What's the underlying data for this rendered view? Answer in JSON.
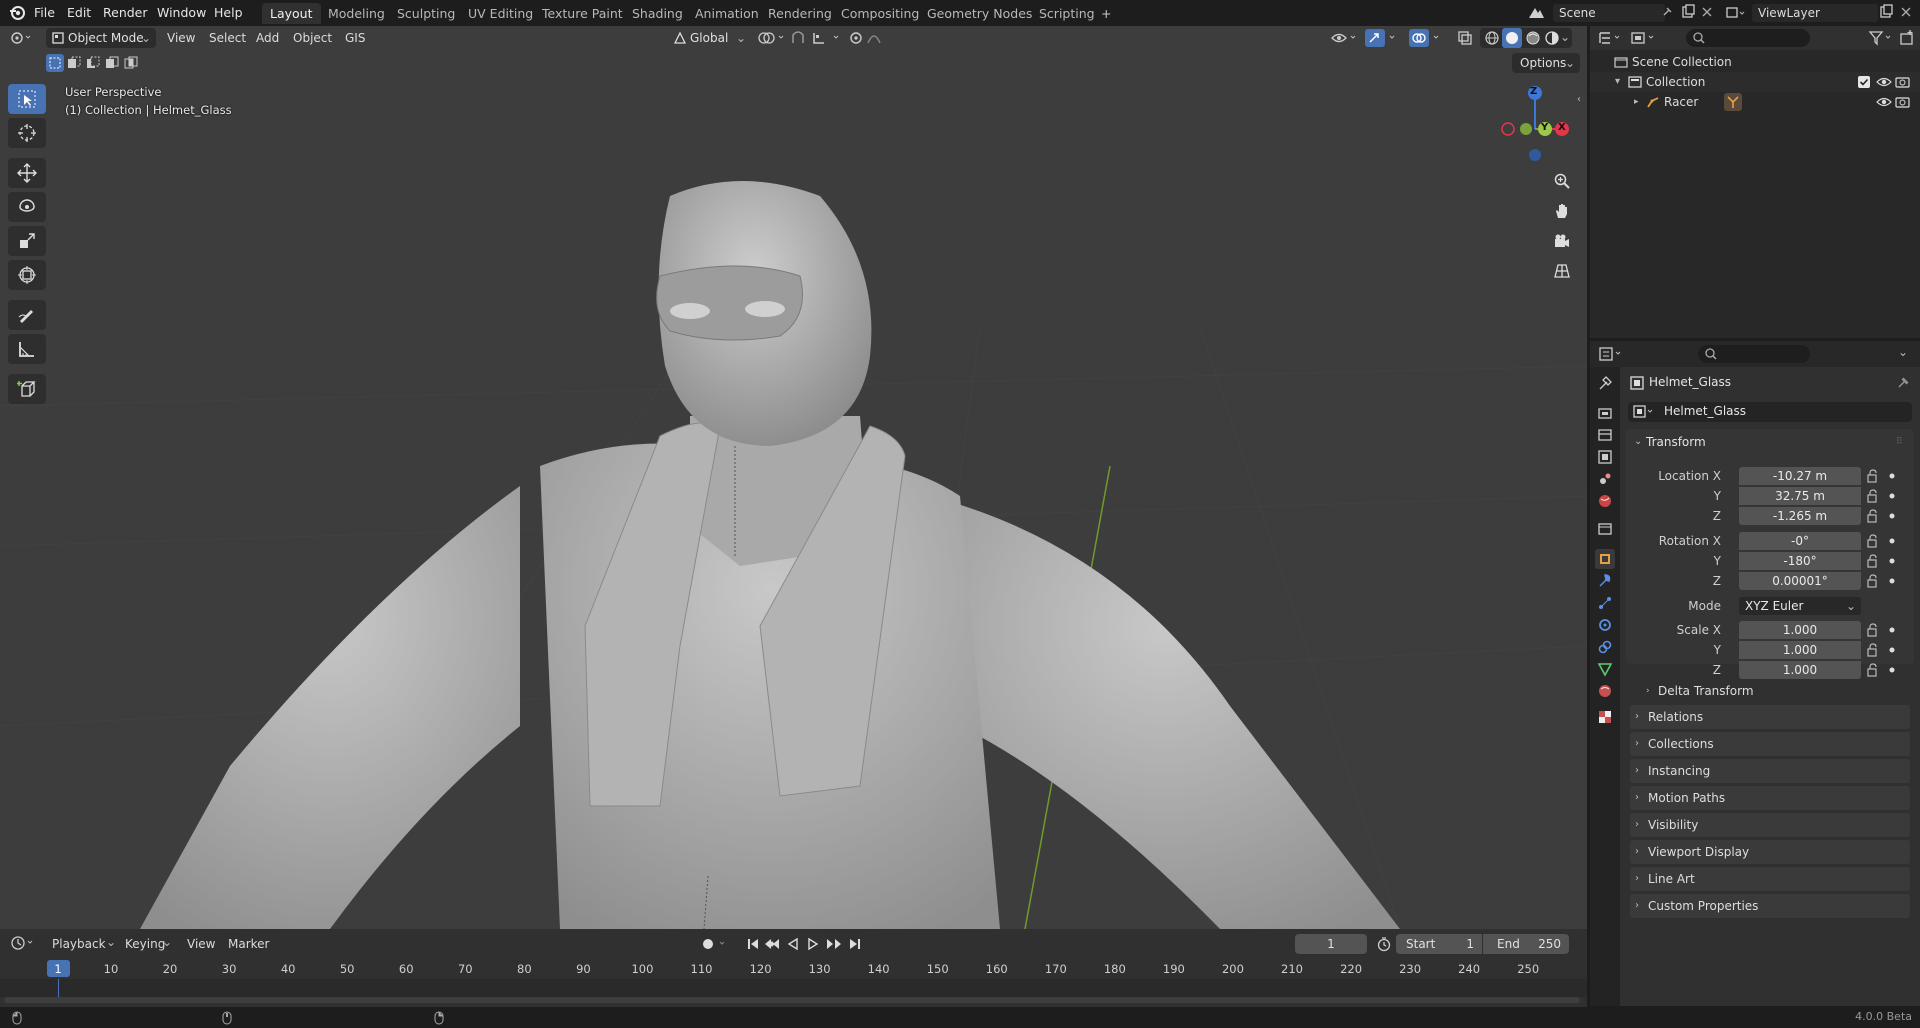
{
  "topbar": {
    "menus": [
      "File",
      "Edit",
      "Render",
      "Window",
      "Help"
    ],
    "workspaces": [
      "Layout",
      "Modeling",
      "Sculpting",
      "UV Editing",
      "Texture Paint",
      "Shading",
      "Animation",
      "Rendering",
      "Compositing",
      "Geometry Nodes",
      "Scripting"
    ],
    "add_workspace": "+",
    "scene_name": "Scene",
    "view_layer": "ViewLayer"
  },
  "viewport": {
    "mode": "Object Mode",
    "menus": [
      "View",
      "Select",
      "Add",
      "Object",
      "GIS"
    ],
    "transform_orientation": "Global",
    "options_label": "Options",
    "perspective_label": "User Perspective",
    "collection_label": "(1) Collection | Helmet_Glass",
    "gizmo": {
      "x": "X",
      "y": "Y",
      "z": "Z"
    }
  },
  "outliner": {
    "scene_collection": "Scene Collection",
    "collection": "Collection",
    "object": "Racer"
  },
  "properties": {
    "object_name": "Helmet_Glass",
    "data_name": "Helmet_Glass",
    "transform_title": "Transform",
    "location": {
      "label": "Location X",
      "x": "-10.27 m",
      "y": "32.75 m",
      "z": "-1.265 m"
    },
    "rotation": {
      "label": "Rotation X",
      "x": "-0°",
      "y": "-180°",
      "z": "0.00001°"
    },
    "mode_label": "Mode",
    "mode_value": "XYZ Euler",
    "scale": {
      "label": "Scale X",
      "x": "1.000",
      "y": "1.000",
      "z": "1.000"
    },
    "axis_y": "Y",
    "axis_z": "Z",
    "delta_transform": "Delta Transform",
    "sections": [
      "Relations",
      "Collections",
      "Instancing",
      "Motion Paths",
      "Visibility",
      "Viewport Display",
      "Line Art",
      "Custom Properties"
    ]
  },
  "timeline": {
    "menus": [
      "Playback",
      "Keying",
      "View",
      "Marker"
    ],
    "current_frame": "1",
    "start_label": "Start",
    "start_value": "1",
    "end_label": "End",
    "end_value": "250",
    "ruler": [
      "1",
      "10",
      "20",
      "30",
      "40",
      "50",
      "60",
      "70",
      "80",
      "90",
      "100",
      "110",
      "120",
      "130",
      "140",
      "150",
      "160",
      "170",
      "180",
      "190",
      "200",
      "210",
      "220",
      "230",
      "240",
      "250"
    ]
  },
  "statusbar": {
    "version": "4.0.0 Beta"
  },
  "colors": {
    "accent": "#4772b3",
    "x_axis": "#e2374b",
    "y_axis": "#7ba33a",
    "z_axis": "#3c78d8",
    "viewport_bg": "#3d3d3d"
  }
}
